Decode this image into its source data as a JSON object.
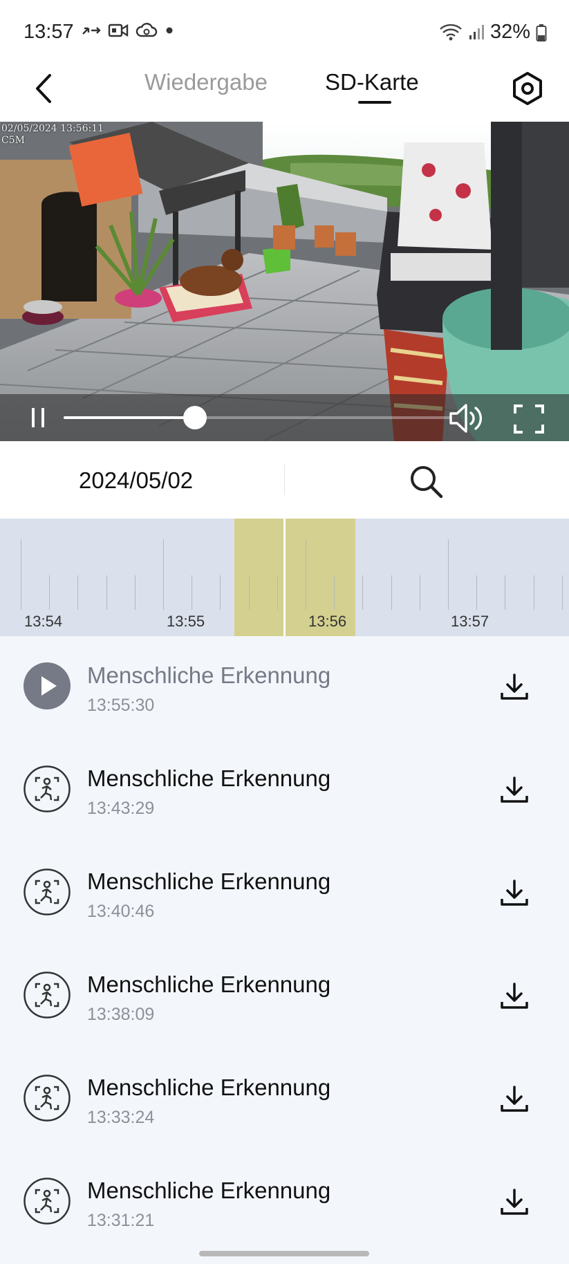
{
  "status_bar": {
    "time": "13:57",
    "battery": "32%",
    "icons_left": [
      "call-forward-icon",
      "video-camera-icon",
      "cloud-sync-icon",
      "dot-icon"
    ],
    "icons_right": [
      "wifi-6-icon",
      "signal-icon",
      "battery-icon"
    ]
  },
  "header": {
    "tabs": [
      {
        "label": "Wiedergabe",
        "active": false
      },
      {
        "label": "SD-Karte",
        "active": true
      }
    ],
    "icons": [
      "back-arrow-icon",
      "settings-hexagon-icon"
    ]
  },
  "video": {
    "overlay_line1": "02/05/2024 13:56:11",
    "overlay_line2": "C5M",
    "progress": 0.34,
    "controls": [
      "pause-icon",
      "volume-icon",
      "fullscreen-icon"
    ]
  },
  "date_bar": {
    "date": "2024/05/02",
    "icon": "search-icon"
  },
  "timeline": {
    "labels": [
      "13:54",
      "13:55",
      "13:56",
      "13:57"
    ],
    "accent_color": "#d4d08f",
    "background_color": "#dae0ec"
  },
  "events": [
    {
      "title": "Menschliche Erkennung",
      "time": "13:55:30",
      "state": "playing",
      "icon": "play-icon",
      "action_icon": "download-icon"
    },
    {
      "title": "Menschliche Erkennung",
      "time": "13:43:29",
      "state": "idle",
      "icon": "person-detection-icon",
      "action_icon": "download-icon"
    },
    {
      "title": "Menschliche Erkennung",
      "time": "13:40:46",
      "state": "idle",
      "icon": "person-detection-icon",
      "action_icon": "download-icon"
    },
    {
      "title": "Menschliche Erkennung",
      "time": "13:38:09",
      "state": "idle",
      "icon": "person-detection-icon",
      "action_icon": "download-icon"
    },
    {
      "title": "Menschliche Erkennung",
      "time": "13:33:24",
      "state": "idle",
      "icon": "person-detection-icon",
      "action_icon": "download-icon"
    },
    {
      "title": "Menschliche Erkennung",
      "time": "13:31:21",
      "state": "idle",
      "icon": "person-detection-icon",
      "action_icon": "download-icon"
    }
  ]
}
